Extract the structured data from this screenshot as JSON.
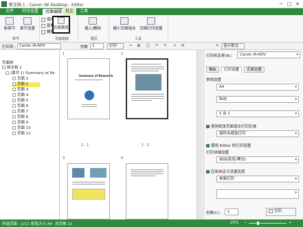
{
  "window": {
    "title": "新文档 1 - Canon iW Desktop - Editor",
    "minimize": "─",
    "maximize": "□",
    "close": "✕"
  },
  "menu": {
    "tabs": [
      "文件",
      "打印设置",
      "页面编辑",
      "批注",
      "工具"
    ],
    "active_index": 2
  },
  "ribbon": {
    "insert_chapter": "新章节",
    "page_settings": "章节设置",
    "edit_label": "编辑",
    "save_page": "保存页",
    "copy": "复制",
    "paste": "粘贴",
    "delete": "删除",
    "print_label": "打印",
    "print_preview": "页面预览",
    "binding_page_group": "页面版面",
    "insert_page": "插入/删除",
    "insert_group": "翻页",
    "move_pages": "缩小页面组合",
    "page_layout": "页面打印设置",
    "tools_group": "工具",
    "group_chapter": "章节"
  },
  "toolbar": {
    "printer_label": "打印到 :",
    "printer_value": "Canon iR-ADV",
    "copies_label": "份数",
    "copies_value": "1",
    "print_button": "打印",
    "display_annotations": "显示批注"
  },
  "left_panel": {
    "title": "页面树",
    "items": [
      {
        "label": "新文档 1",
        "level": 0
      },
      {
        "label": "(章节 1) Summary of Re",
        "level": 1
      },
      {
        "label": "页面 1",
        "level": 2
      },
      {
        "label": "页面 2",
        "level": 2
      },
      {
        "label": "页面 3",
        "level": 2
      },
      {
        "label": "页面 4",
        "level": 2
      },
      {
        "label": "页面 5",
        "level": 2
      },
      {
        "label": "页面 6",
        "level": 2
      },
      {
        "label": "页面 7",
        "level": 2
      },
      {
        "label": "页面 8",
        "level": 2
      },
      {
        "label": "页面 9",
        "level": 2
      },
      {
        "label": "页面 10",
        "level": 2
      },
      {
        "label": "页面 11",
        "level": 2
      }
    ],
    "selected_index": 3
  },
  "center": {
    "pages": [
      {
        "number": "1",
        "caption": "1 - 1",
        "title": "Summary of Research"
      },
      {
        "number": "2",
        "caption": "1 - 2",
        "title": ""
      },
      {
        "number": "3",
        "caption": "",
        "title": ""
      },
      {
        "number": "4",
        "caption": "",
        "title": ""
      }
    ]
  },
  "right_panel": {
    "printer_label": "打印机名称(R):",
    "printer_value": "Canon iR-ADV",
    "tabs": [
      "模板",
      "打印设置",
      "页面设置"
    ],
    "active_tab": 1,
    "section_basic": "常规设置",
    "paper_size": "A4",
    "orientation": "纵向",
    "nup": "1 合 1",
    "check_fit": "使用纸张页面适合打印区域",
    "fit_option": "按符合纸张打印",
    "check_editor": "使用 Editor 的打印设置",
    "section_color": "打印详细设置",
    "color_mode": "自动(彩色/黑白)",
    "check_default": "应用自定义设置还原",
    "duplex": "单面打印",
    "copies_label": "份数(C):",
    "copies_value": "1",
    "print_button": "打印"
  },
  "status": {
    "selected_pages": "所选页面 : 2/11",
    "paper_size": "纸张大小 A4",
    "total_pages": "总页数 11",
    "zoom": "25%"
  },
  "colors": {
    "brand": "#2f8a3e",
    "selection": "#f2e95b"
  }
}
